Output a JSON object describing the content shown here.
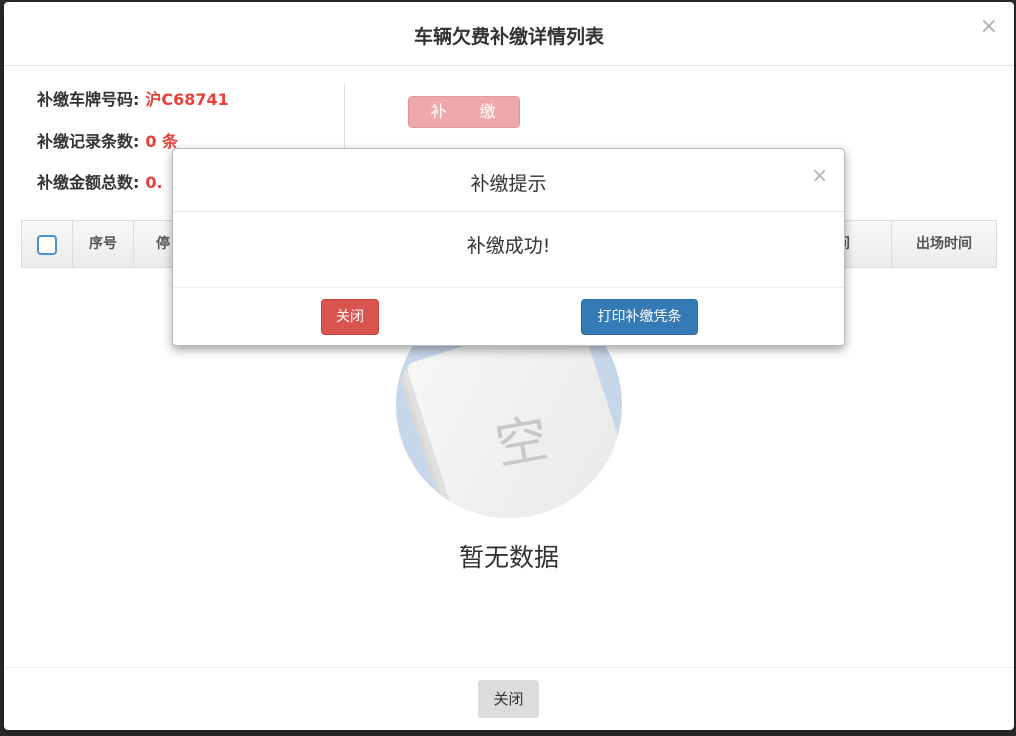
{
  "modal": {
    "title": "车辆欠费补缴详情列表",
    "close_x": "×",
    "info": [
      {
        "label": "补缴车牌号码:",
        "value": "沪C68741"
      },
      {
        "label": "补缴记录条数:",
        "value": "0 条"
      },
      {
        "label": "补缴金额总数:",
        "value": "0."
      }
    ],
    "pay_button": "补 缴",
    "table_headers": {
      "seq": "序号",
      "park": "停",
      "entry_time_partial": "时间",
      "exit_time": "出场时间"
    },
    "empty_char": "空",
    "empty_text": "暂无数据",
    "footer_close": "关闭"
  },
  "dialog": {
    "title": "补缴提示",
    "close_x": "×",
    "message": "补缴成功!",
    "close_button": "关闭",
    "print_button": "打印补缴凭条"
  },
  "colors": {
    "accent_red": "#e8413a",
    "primary_blue": "#337ab7",
    "danger_red": "#d9534f"
  }
}
